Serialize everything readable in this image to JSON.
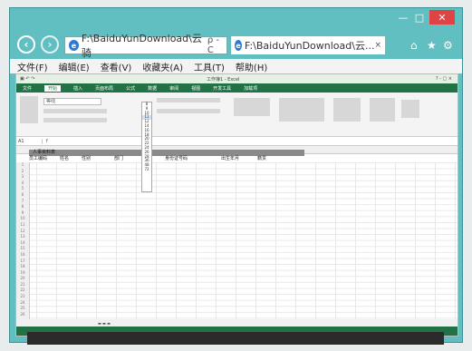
{
  "browser": {
    "address_text": "F:\\BaiduYunDownload\\云骑",
    "address_tools": "ρ - C",
    "tab_title": "F:\\BaiduYunDownload\\云...",
    "tab_close": "×",
    "win_min": "—",
    "win_max": "□",
    "win_close": "✕",
    "home_icon": "⌂",
    "star_icon": "★",
    "gear_icon": "⚙"
  },
  "menu": [
    "文件(F)",
    "编辑(E)",
    "查看(V)",
    "收藏夹(A)",
    "工具(T)",
    "帮助(H)"
  ],
  "excel": {
    "title_center": "工作簿1 - Excel",
    "title_right": "? - □ ×",
    "tabs": [
      "文件",
      "开始",
      "插入",
      "页面布局",
      "公式",
      "数据",
      "审阅",
      "视图",
      "开发工具",
      "加载项"
    ],
    "active_tab": "开始",
    "font_name": "等线",
    "formula_cell": "A1",
    "formula_fx": "f",
    "sheet_title": "人事资料表",
    "headers": [
      "员工编码",
      "姓名",
      "性别",
      "部门",
      "身份证号码",
      "出生年月",
      "籍贯"
    ],
    "font_sizes": [
      "8",
      "9",
      "10",
      "11",
      "12",
      "14",
      "16",
      "18",
      "20",
      "22",
      "24",
      "26",
      "28",
      "36",
      "48",
      "72"
    ],
    "selected_size": "11"
  }
}
